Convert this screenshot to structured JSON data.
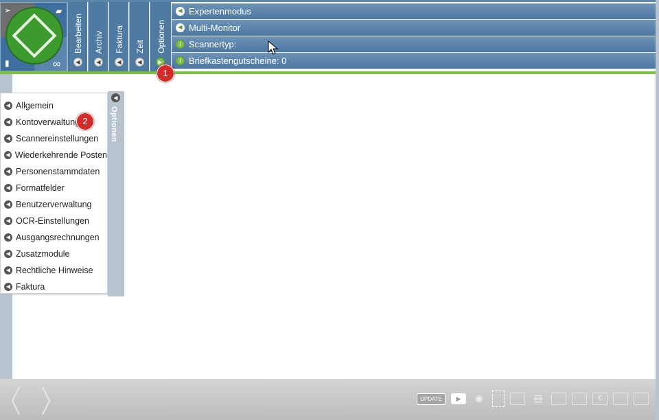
{
  "toolbar": {
    "tabs": [
      {
        "label": "Bearbeiten"
      },
      {
        "label": "Archiv"
      },
      {
        "label": "Faktura"
      },
      {
        "label": "Zeit"
      },
      {
        "label": "Optionen"
      }
    ]
  },
  "menu": {
    "items": [
      {
        "label": "Expertenmodus",
        "icon": "chevron-left-icon"
      },
      {
        "label": "Multi-Monitor",
        "icon": "chevron-left-icon"
      },
      {
        "label": "Scannertyp:",
        "icon": "info-icon"
      },
      {
        "label": "Briefkastengutscheine: 0",
        "icon": "info-icon"
      }
    ]
  },
  "options_panel": {
    "title": "Optionen",
    "items": [
      {
        "label": "Allgemein"
      },
      {
        "label": "Kontoverwaltung"
      },
      {
        "label": "Scannereinstellungen"
      },
      {
        "label": "Wiederkehrende Posten"
      },
      {
        "label": "Personenstammdaten"
      },
      {
        "label": "Formatfelder"
      },
      {
        "label": "Benutzerverwaltung"
      },
      {
        "label": "OCR-Einstellungen"
      },
      {
        "label": "Ausgangsrechnungen"
      },
      {
        "label": "Zusatzmodule"
      },
      {
        "label": "Rechtliche Hinweise"
      },
      {
        "label": "Faktura"
      }
    ]
  },
  "badges": {
    "one": "1",
    "two": "2"
  },
  "bottom": {
    "update_label": "UPDATE"
  },
  "colors": {
    "accent_green": "#7cc043",
    "header_blue": "#4f7ba2",
    "badge_red": "#d42b2b"
  }
}
